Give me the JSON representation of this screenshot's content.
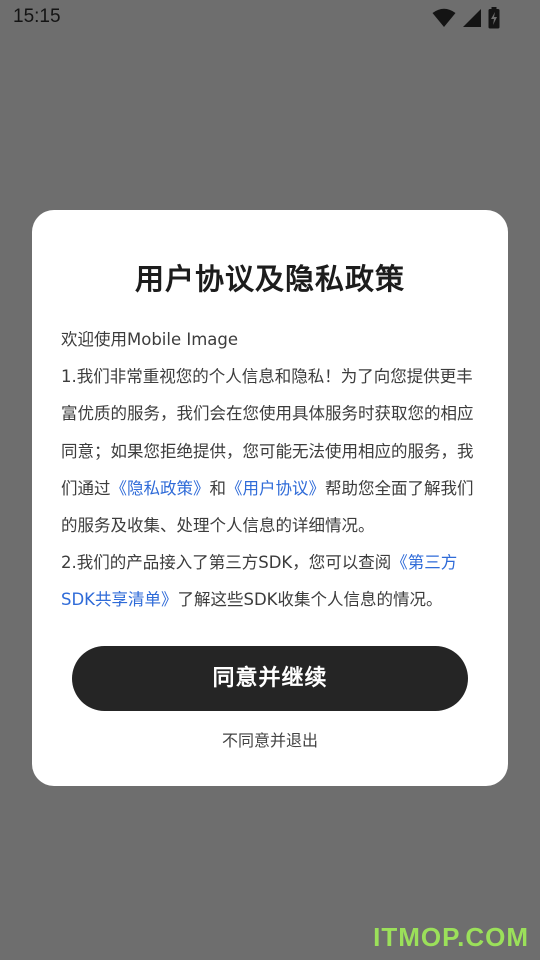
{
  "status_bar": {
    "time": "15:15",
    "icons": [
      "wifi-icon",
      "signal-icon",
      "battery-charging-icon"
    ]
  },
  "dialog": {
    "title": "用户协议及隐私政策",
    "greeting": "欢迎使用Mobile Image",
    "para1_text": "1.我们非常重视您的个人信息和隐私！为了向您提供更丰富优质的服务，我们会在您使用具体服务时获取您的相应同意；如果您拒绝提供，您可能无法使用相应的服务，我们通过",
    "privacy_link": "《隐私政策》",
    "and": "和",
    "user_agreement_link": "《用户协议》",
    "para1_tail": "帮助您全面了解我们的服务及收集、处理个人信息的详细情况。",
    "para2_text": "2.我们的产品接入了第三方SDK，您可以查阅",
    "sdk_link": "《第三方SDK共享清单》",
    "para2_tail": "了解这些SDK收集个人信息的情况。",
    "agree_button": "同意并继续",
    "disagree_link": "不同意并退出"
  },
  "watermark": "ITMOP.COM",
  "colors": {
    "overlay": "#6e6e6e",
    "link": "#2f6bd8",
    "button": "#252525",
    "watermark": "#9be05a"
  }
}
